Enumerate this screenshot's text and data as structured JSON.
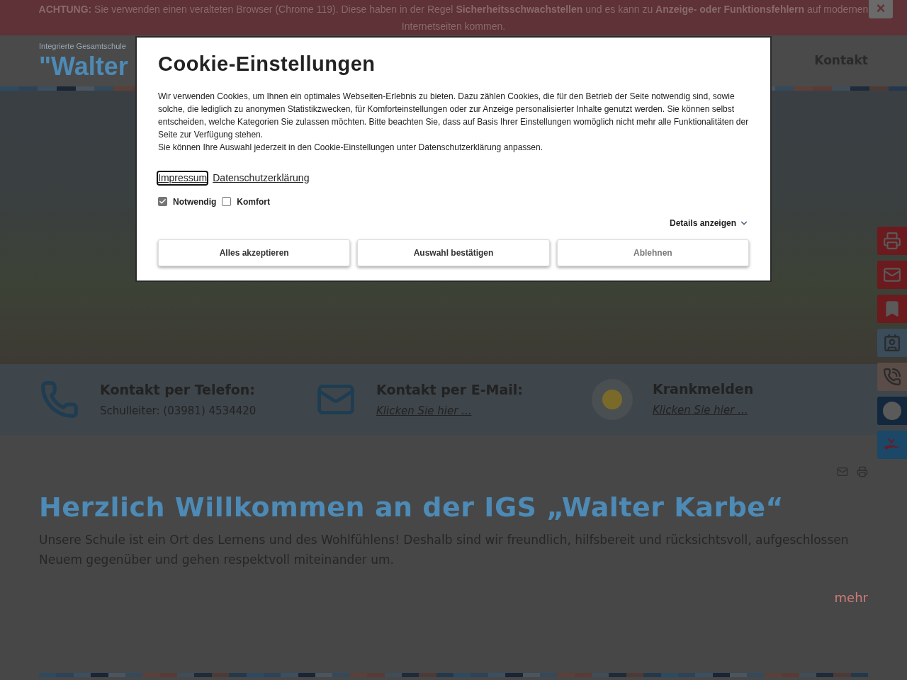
{
  "warning_banner": {
    "text": "**ACHTUNG:** Sie verwenden einen veralteten Browser (Chrome 119). Diese haben in der Regel **Sicherheitsschwachstellen** und es kann zu **Anzeige- oder Funktionsfehlern** auf modernen Internetseiten kommen.",
    "close_label": "×"
  },
  "header": {
    "subtitle": "Integrierte Gesamtschule",
    "title": "\"Walter",
    "nav": [
      "Kontakt"
    ]
  },
  "cookie_dialog": {
    "title": "Cookie-Einstellungen",
    "text": "Wir verwenden Cookies, um Ihnen ein optimales Webseiten-Erlebnis zu bieten. Dazu zählen Cookies, die für den Betrieb der Seite notwendig sind, sowie solche, die lediglich zu anonymen Statistikzwecken, für Komforteinstellungen oder zur Anzeige personalisierter Inhalte genutzt werden. Sie können selbst entscheiden, welche Kategorien Sie zulassen möchten. Bitte beachten Sie, dass auf Basis Ihrer Einstellungen womöglich nicht mehr alle Funktionalitäten der Seite zur Verfügung stehen.",
    "text2": "Sie können Ihre Auswahl jederzeit in den Cookie-Einstellungen unter Datenschutzerklärung anpassen.",
    "links": [
      {
        "label": "Impressum",
        "focused": true
      },
      {
        "label": "Datenschutzerklärung",
        "focused": false
      }
    ],
    "options": [
      {
        "label": "Notwendig",
        "checked": true,
        "disabled": true
      },
      {
        "label": "Komfort",
        "checked": false,
        "disabled": false
      }
    ],
    "details_label": "Details anzeigen",
    "buttons": [
      {
        "label": "Alles akzeptieren",
        "muted": false
      },
      {
        "label": "Auswahl bestätigen",
        "muted": false
      },
      {
        "label": "Ablehnen",
        "muted": true
      }
    ]
  },
  "contacts": [
    {
      "kind": "phone",
      "title": "Kontakt per Telefon:",
      "text": "Schulleiter: (03981) 4534420",
      "link": false
    },
    {
      "kind": "mail",
      "title": "Kontakt per E-Mail:",
      "text": "Klicken Sie hier ...",
      "link": true
    },
    {
      "kind": "sick",
      "title": "Krankmelden",
      "text": "Klicken Sie hier ...",
      "link": true
    }
  ],
  "side_buttons": [
    {
      "kind": "print",
      "color": "#6b1a1e"
    },
    {
      "kind": "mail",
      "color": "#6b1a1e"
    },
    {
      "kind": "bookmark",
      "color": "#6b1a1e"
    },
    {
      "kind": "contact",
      "color": "#3b4c5a"
    },
    {
      "kind": "call",
      "color": "#5a4c47"
    },
    {
      "kind": "sick",
      "color": "#13283d"
    },
    {
      "kind": "logo",
      "color": "#1b4867"
    }
  ],
  "article": {
    "title": "Herzlich Willkommen an der IGS „Walter Karbe“",
    "text": "Unsere Schule ist ein Ort des Lernens und des Wohlfühlens! Deshalb sind wir freundlich, hilfsbereit und rücksichtsvoll, aufgeschlossen Neuem gegenüber und gehen respektvoll miteinander um.",
    "more": "mehr"
  }
}
